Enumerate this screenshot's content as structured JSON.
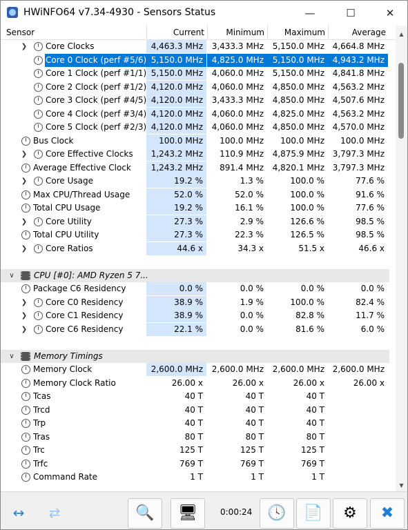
{
  "window": {
    "title": "HWiNFO64 v7.34-4930 - Sensors Status"
  },
  "controls": {
    "minimize": "—",
    "maximize": "☐",
    "close": "✕"
  },
  "columns": {
    "sensor": "Sensor",
    "current": "Current",
    "minimum": "Minimum",
    "maximum": "Maximum",
    "average": "Average"
  },
  "rows": [
    {
      "label": "Core Clocks",
      "cur": "4,463.3 MHz",
      "min": "3,433.3 MHz",
      "max": "5,150.0 MHz",
      "avg": "4,664.8 MHz"
    },
    {
      "label": "Core 0 Clock (perf #5/6)",
      "cur": "5,150.0 MHz",
      "min": "4,825.0 MHz",
      "max": "5,150.0 MHz",
      "avg": "4,943.2 MHz"
    },
    {
      "label": "Core 1 Clock (perf #1/1)",
      "cur": "5,150.0 MHz",
      "min": "4,060.0 MHz",
      "max": "5,150.0 MHz",
      "avg": "4,841.8 MHz"
    },
    {
      "label": "Core 2 Clock (perf #1/2)",
      "cur": "4,120.0 MHz",
      "min": "4,060.0 MHz",
      "max": "4,850.0 MHz",
      "avg": "4,563.2 MHz"
    },
    {
      "label": "Core 3 Clock (perf #4/5)",
      "cur": "4,120.0 MHz",
      "min": "3,433.3 MHz",
      "max": "4,850.0 MHz",
      "avg": "4,507.6 MHz"
    },
    {
      "label": "Core 4 Clock (perf #3/4)",
      "cur": "4,120.0 MHz",
      "min": "4,060.0 MHz",
      "max": "4,825.0 MHz",
      "avg": "4,563.2 MHz"
    },
    {
      "label": "Core 5 Clock (perf #2/3)",
      "cur": "4,120.0 MHz",
      "min": "4,060.0 MHz",
      "max": "4,850.0 MHz",
      "avg": "4,570.0 MHz"
    },
    {
      "label": "Bus Clock",
      "cur": "100.0 MHz",
      "min": "100.0 MHz",
      "max": "100.0 MHz",
      "avg": "100.0 MHz"
    },
    {
      "label": "Core Effective Clocks",
      "cur": "1,243.2 MHz",
      "min": "110.9 MHz",
      "max": "4,875.9 MHz",
      "avg": "3,797.3 MHz"
    },
    {
      "label": "Average Effective Clock",
      "cur": "1,243.2 MHz",
      "min": "891.4 MHz",
      "max": "4,820.1 MHz",
      "avg": "3,797.3 MHz"
    },
    {
      "label": "Core Usage",
      "cur": "19.2 %",
      "min": "1.3 %",
      "max": "100.0 %",
      "avg": "77.6 %"
    },
    {
      "label": "Max CPU/Thread Usage",
      "cur": "52.0 %",
      "min": "52.0 %",
      "max": "100.0 %",
      "avg": "91.6 %"
    },
    {
      "label": "Total CPU Usage",
      "cur": "19.2 %",
      "min": "16.1 %",
      "max": "100.0 %",
      "avg": "77.6 %"
    },
    {
      "label": "Core Utility",
      "cur": "27.3 %",
      "min": "2.9 %",
      "max": "126.6 %",
      "avg": "98.5 %"
    },
    {
      "label": "Total CPU Utility",
      "cur": "27.3 %",
      "min": "22.3 %",
      "max": "126.5 %",
      "avg": "98.5 %"
    },
    {
      "label": "Core Ratios",
      "cur": "44.6 x",
      "min": "34.3 x",
      "max": "51.5 x",
      "avg": "46.6 x"
    },
    {
      "label": "",
      "cur": "",
      "min": "",
      "max": "",
      "avg": ""
    },
    {
      "label": "CPU [#0]: AMD Ryzen 5 7...",
      "cur": "",
      "min": "",
      "max": "",
      "avg": ""
    },
    {
      "label": "Package C6 Residency",
      "cur": "0.0 %",
      "min": "0.0 %",
      "max": "0.0 %",
      "avg": "0.0 %"
    },
    {
      "label": "Core C0 Residency",
      "cur": "38.9 %",
      "min": "1.9 %",
      "max": "100.0 %",
      "avg": "82.4 %"
    },
    {
      "label": "Core C1 Residency",
      "cur": "38.9 %",
      "min": "0.0 %",
      "max": "82.8 %",
      "avg": "11.7 %"
    },
    {
      "label": "Core C6 Residency",
      "cur": "22.1 %",
      "min": "0.0 %",
      "max": "81.6 %",
      "avg": "6.0 %"
    },
    {
      "label": "",
      "cur": "",
      "min": "",
      "max": "",
      "avg": ""
    },
    {
      "label": "Memory Timings",
      "cur": "",
      "min": "",
      "max": "",
      "avg": ""
    },
    {
      "label": "Memory Clock",
      "cur": "2,600.0 MHz",
      "min": "2,600.0 MHz",
      "max": "2,600.0 MHz",
      "avg": "2,600.0 MHz"
    },
    {
      "label": "Memory Clock Ratio",
      "cur": "26.00 x",
      "min": "26.00 x",
      "max": "26.00 x",
      "avg": "26.00 x"
    },
    {
      "label": "Tcas",
      "cur": "40 T",
      "min": "40 T",
      "max": "40 T",
      "avg": ""
    },
    {
      "label": "Trcd",
      "cur": "40 T",
      "min": "40 T",
      "max": "40 T",
      "avg": ""
    },
    {
      "label": "Trp",
      "cur": "40 T",
      "min": "40 T",
      "max": "40 T",
      "avg": ""
    },
    {
      "label": "Tras",
      "cur": "80 T",
      "min": "80 T",
      "max": "80 T",
      "avg": ""
    },
    {
      "label": "Trc",
      "cur": "125 T",
      "min": "125 T",
      "max": "125 T",
      "avg": ""
    },
    {
      "label": "Trfc",
      "cur": "769 T",
      "min": "769 T",
      "max": "769 T",
      "avg": ""
    },
    {
      "label": "Command Rate",
      "cur": "1 T",
      "min": "1 T",
      "max": "1 T",
      "avg": ""
    }
  ],
  "toolbar": {
    "timer": "0:00:24"
  },
  "icons": {
    "expand": "expand-arrows-icon",
    "collapse": "collapse-arrows-icon",
    "search": "search-icon",
    "network": "network-icon",
    "clock": "clock-icon",
    "report": "report-add-icon",
    "settings": "gear-icon",
    "close": "close-icon"
  },
  "colors": {
    "current_col_bg": "#d3e6fb",
    "selection": "#0078d7",
    "group_bg": "#e8e8e8"
  }
}
